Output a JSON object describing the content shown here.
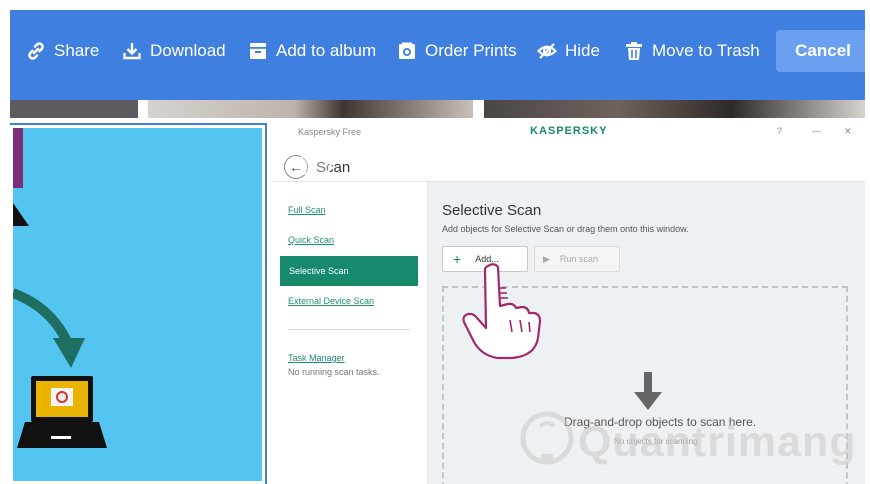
{
  "toolbar": {
    "share_label": "Share",
    "download_label": "Download",
    "add_to_album_label": "Add to album",
    "order_prints_label": "Order Prints",
    "hide_label": "Hide",
    "move_to_trash_label": "Move to Trash",
    "cancel_label": "Cancel"
  },
  "photo": {
    "window_title": "Kaspersky Free",
    "brand": "KASPERSKY",
    "header_title": "Scan",
    "sidebar": {
      "items": [
        {
          "label": "Full Scan"
        },
        {
          "label": "Quick Scan"
        },
        {
          "label": "Selective Scan",
          "active": true
        },
        {
          "label": "External Device Scan"
        }
      ],
      "task_manager_label": "Task Manager",
      "task_status": "No running scan tasks."
    },
    "main": {
      "title": "Selective Scan",
      "description": "Add objects for Selective Scan or drag them onto this window.",
      "add_button": "Add...",
      "run_scan_button": "Run scan",
      "drop_text": "Drag-and-drop objects to scan here.",
      "drop_subtext": "No objects for scanning"
    },
    "watermark": "Quantrimang"
  },
  "colors": {
    "toolbar_bg": "#3f7fe0",
    "kaspersky_green": "#178a6c",
    "left_tile_bg": "#54c4f0"
  }
}
